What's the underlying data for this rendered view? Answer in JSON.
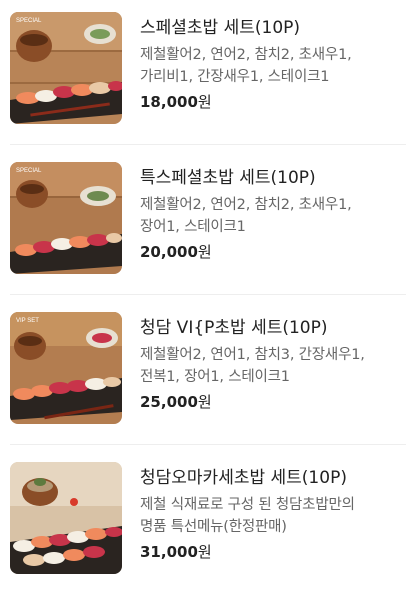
{
  "menu": {
    "items": [
      {
        "title": "스페셜초밥 세트(10P)",
        "desc1": "제철활어2, 연어2, 참치2, 초새우1,",
        "desc2": "가리비1, 간장새우1, 스테이크1",
        "price": "18,000",
        "currency": "원",
        "badge": "SPECIAL"
      },
      {
        "title": "특스페셜초밥 세트(10P)",
        "desc1": "제철활어2, 연어2, 참치2, 초새우1,",
        "desc2": "장어1, 스테이크1",
        "price": "20,000",
        "currency": "원",
        "badge": "SPECIAL"
      },
      {
        "title": "청담 VI{P초밥 세트(10P)",
        "desc1": "제철활어2, 연어1, 참치3, 간장새우1,",
        "desc2": "전복1, 장어1, 스테이크1",
        "price": "25,000",
        "currency": "원",
        "badge": "VIP SET"
      },
      {
        "title": "청담오마카세초밥 세트(10P)",
        "desc1": "제철 식재료로 구성 된 청담초밥만의",
        "desc2": "명품 특선메뉴(한정판매)",
        "price": "31,000",
        "currency": "원",
        "badge": ""
      }
    ]
  },
  "colors": {
    "wood": "#b07a4e",
    "plate": "#2a2420",
    "salmon": "#f08a5d",
    "tuna": "#c8344a",
    "rice": "#f5efe4"
  }
}
